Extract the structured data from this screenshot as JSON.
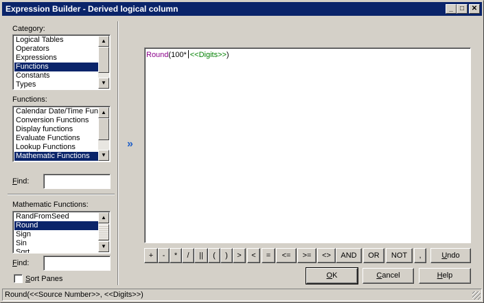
{
  "window": {
    "title": "Expression Builder - Derived logical column",
    "minimize_glyph": "_",
    "maximize_glyph": "□",
    "close_glyph": "✕"
  },
  "category": {
    "label_pre": "Category",
    "label_post": ":",
    "items": [
      "Logical Tables",
      "Operators",
      "Expressions",
      "Functions",
      "Constants",
      "Types"
    ],
    "selected": "Functions"
  },
  "functions": {
    "label": "Functions:",
    "items": [
      "Calendar Date/Time Func",
      "Conversion Functions",
      "Display functions",
      "Evaluate Functions",
      "Lookup Functions",
      "Mathematic Functions"
    ],
    "selected": "Mathematic Functions"
  },
  "find1": {
    "label_key": "F",
    "label_rest": "ind:",
    "value": ""
  },
  "math_functions": {
    "label": "Mathematic Functions:",
    "items": [
      "RandFromSeed",
      "Round",
      "Sign",
      "Sin",
      "Sqrt"
    ],
    "selected": "Round"
  },
  "find2": {
    "label_key": "F",
    "label_rest": "ind:",
    "value": ""
  },
  "sort_panes": {
    "label_pre": "S",
    "label_rest": "ort Panes",
    "checked": false
  },
  "insert_arrow": "»",
  "editor": {
    "fn_name": "Round",
    "text_before": "(100*",
    "placeholder": "<<Digits>>",
    "text_after": ")"
  },
  "operators": [
    "+",
    "-",
    "*",
    "/",
    "||",
    "(",
    ")",
    ">",
    "<",
    "=",
    "<=",
    ">=",
    "<>",
    "AND",
    "OR",
    "NOT",
    ","
  ],
  "buttons": {
    "undo_key": "U",
    "undo_rest": "ndo",
    "ok_key": "O",
    "ok_rest": "K",
    "cancel_key": "C",
    "cancel_rest": "ancel",
    "help_key": "H",
    "help_rest": "elp"
  },
  "status": {
    "text": "Round(<<Source Number>>, <<Digits>>)"
  },
  "colors": {
    "titlebar": "#0a246a",
    "selection": "#0a246a",
    "function_name": "#8b008b",
    "placeholder": "#008000",
    "arrow": "#1f5fc8"
  }
}
